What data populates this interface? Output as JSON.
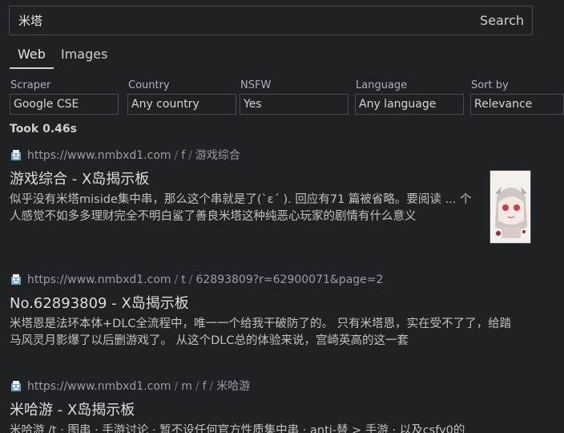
{
  "search": {
    "query": "米塔",
    "placeholder": "",
    "button_label": "Search"
  },
  "tabs": [
    {
      "label": "Web",
      "active": true
    },
    {
      "label": "Images",
      "active": false
    }
  ],
  "filters": [
    {
      "label": "Scraper",
      "value": "Google CSE"
    },
    {
      "label": "Country",
      "value": "Any country"
    },
    {
      "label": "NSFW",
      "value": "Yes"
    },
    {
      "label": "Language",
      "value": "Any language"
    },
    {
      "label": "Sort by",
      "value": "Relevance"
    }
  ],
  "took": "Took 0.46s",
  "results": [
    {
      "url_base": "https://www.nmbxd1.com",
      "url_parts": [
        "f",
        "游戏综合"
      ],
      "title": "游戏综合 - X岛揭示板",
      "snippet": "似乎没有米塔miside集中串，那么这个串就是了(`ε´ ). 回应有71 篇被省略。要阅读 ... 个人感觉不如多多理财完全不明白鲨了善良米塔这种纯恶心玩家的剧情有什么意义"
    },
    {
      "url_base": "https://www.nmbxd1.com",
      "url_parts": [
        "t",
        "62893809?r=62900071&page=2"
      ],
      "title": "No.62893809 - X岛揭示板",
      "snippet": "米塔恩是法环本体+DLC全流程中，唯一一个给我干破防了的。 只有米塔恩，实在受不了了，给踏马风灵月影爆了以后删游戏了。 从这个DLC总的体验来说，宫崎英高的这一套"
    },
    {
      "url_base": "https://www.nmbxd1.com",
      "url_parts": [
        "m",
        "f",
        "米哈游"
      ],
      "title": "米哈游 - X岛揭示板",
      "snippet": "米哈游 /t · 图串 · 手游讨论 · 暂不设任何官方性质集中串 · anti-替 > 手游 · 以及csfy0的"
    }
  ]
}
